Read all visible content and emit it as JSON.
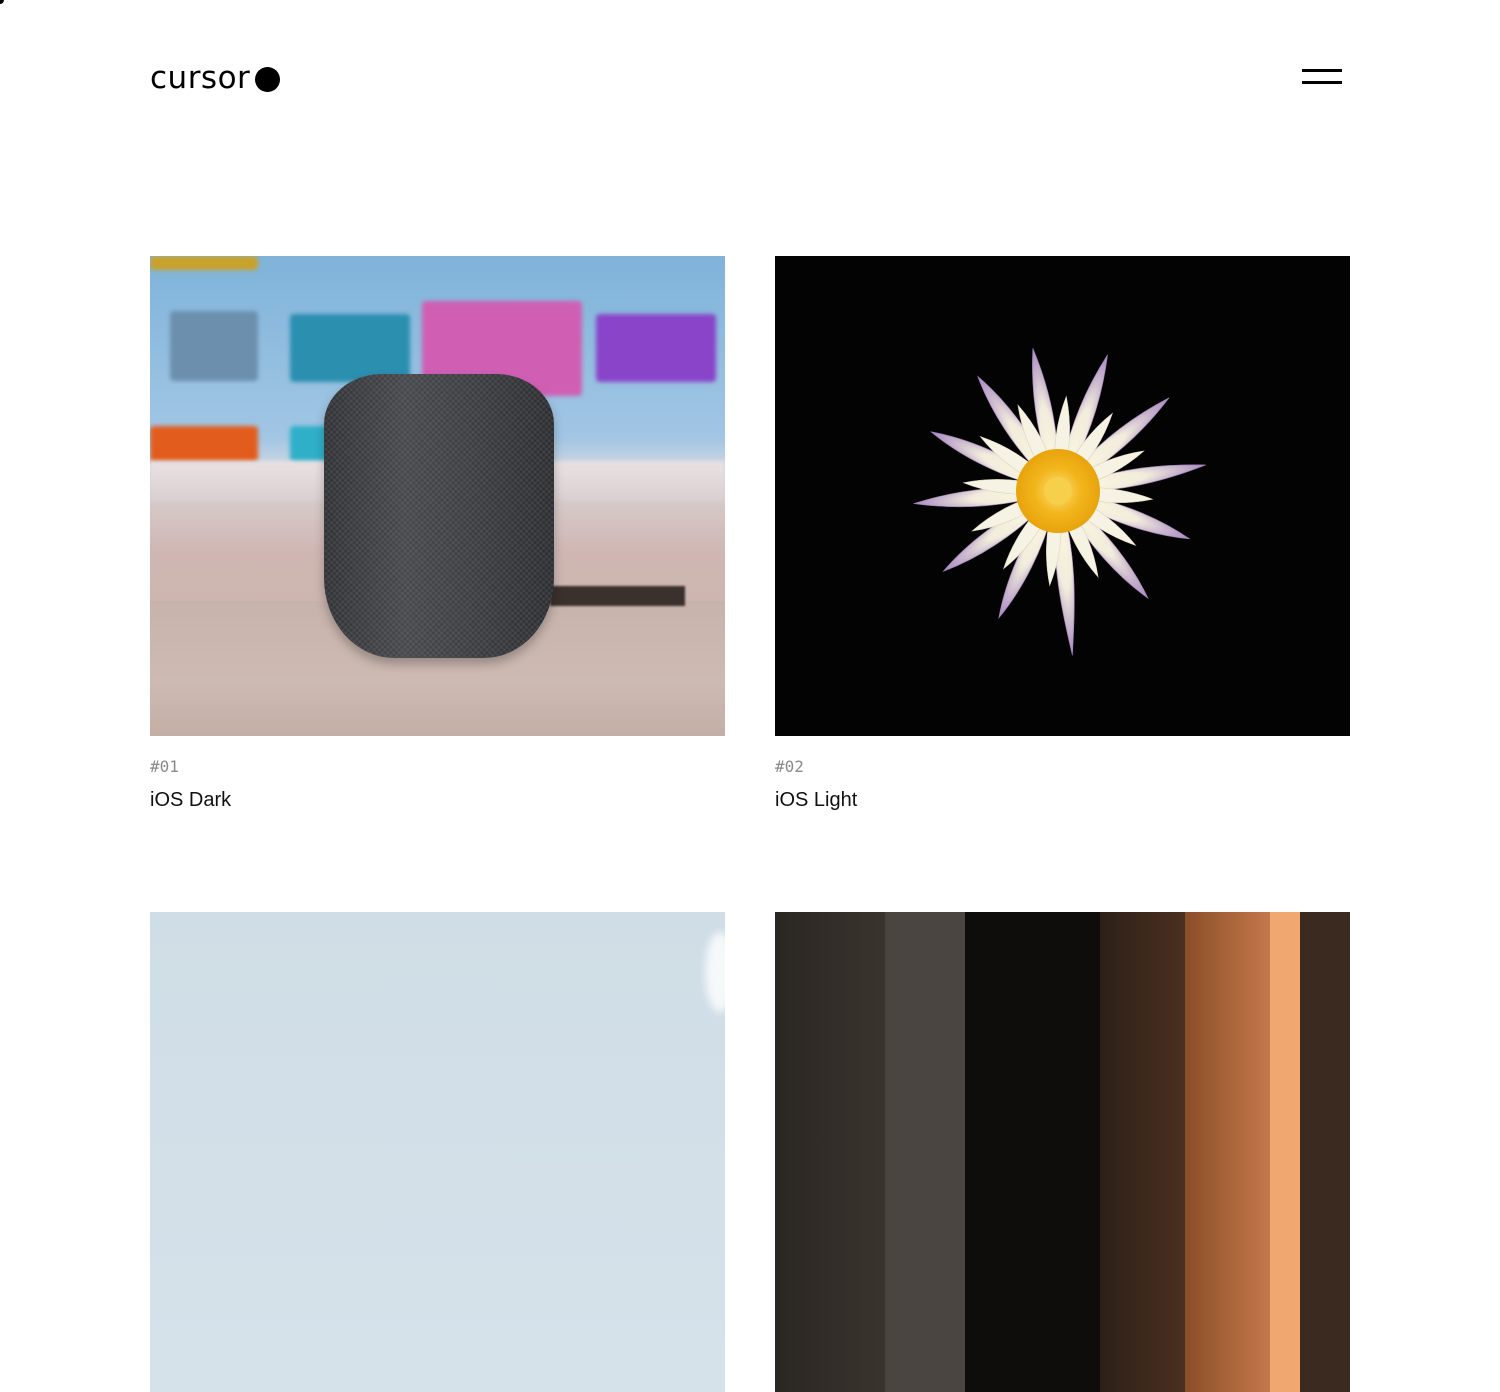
{
  "header": {
    "logo_text": "cursor",
    "menu_icon": "hamburger-icon"
  },
  "projects": [
    {
      "number": "#01",
      "title": "iOS Dark",
      "image": "smart-speaker-photo"
    },
    {
      "number": "#02",
      "title": "iOS Light",
      "image": "water-lily-photo"
    },
    {
      "number": "",
      "title": "",
      "image": "sky-photo"
    },
    {
      "number": "",
      "title": "",
      "image": "architecture-photo"
    }
  ],
  "colors": {
    "background": "#ffffff",
    "text": "#111111",
    "muted": "#8a8a8a"
  }
}
